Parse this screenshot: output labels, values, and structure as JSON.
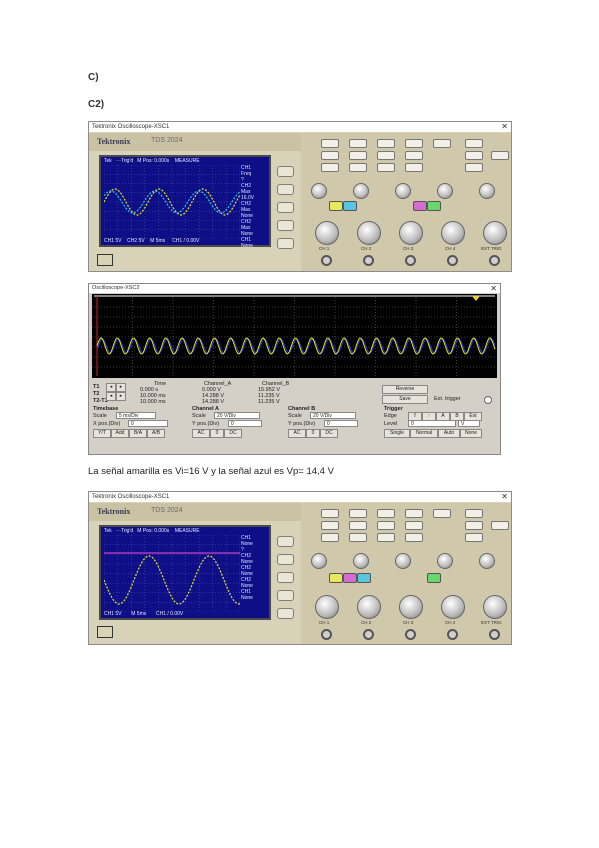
{
  "doc": {
    "heading_c": "C)",
    "heading_c2": "C2)",
    "caption": "La señal amarilla es Vi=16 V y la señal azul es Vp= 14,4 V"
  },
  "scope1": {
    "window_title": "Tektronix Oscilloscope-XSC1",
    "brand": "Tektronix",
    "model": "TDS 2024",
    "lcd_top": [
      "Tek",
      "···Trig'd",
      "M Pos: 0.000s",
      "MEASURE"
    ],
    "menu": [
      "CH1",
      "Freq",
      "?",
      "CH2",
      "Max",
      "16.0V",
      "CH2",
      "Max",
      "None",
      "CH2",
      "Max",
      "None",
      "CH1",
      "None"
    ],
    "lcd_bottom": [
      "CH1 5V",
      "CH2 5V",
      "M 5ms",
      "CH1 / 0.00V"
    ],
    "channels": [
      "CH 1",
      "CH 2",
      "CH 3",
      "CH 4",
      "EXT TRIG"
    ],
    "wave_color_a": "#e6e62a",
    "wave_color_b": "#29c6dc",
    "close": "✕"
  },
  "scope2": {
    "window_title": "Tektronix Oscilloscope-XSC1",
    "brand": "Tektronix",
    "model": "TDS 2024",
    "lcd_top": [
      "Tek",
      "···Trig'd",
      "M Pos: 0.000s",
      "MEASURE"
    ],
    "menu": [
      "CH1",
      "None",
      "?",
      "CH2",
      "None",
      "CH2",
      "None",
      "CH2",
      "None",
      "CH1",
      "None"
    ],
    "lcd_bottom": [
      "CH1 5V",
      "M 5ms",
      "CH1 / 0.00V"
    ],
    "channels": [
      "CH 1",
      "CH 2",
      "CH 3",
      "CH 4",
      "EXT TRIG"
    ],
    "wave_color_a": "#e6e62a",
    "wave_color_b": "#d43cc9",
    "close": "✕"
  },
  "trace": {
    "window_title": "Oscilloscope-XSC2",
    "close": "✕",
    "table_headers": [
      "Time",
      "Channel_A",
      "Channel_B"
    ],
    "rows": [
      [
        "0.000 s",
        "0.000 V",
        "15.952 V"
      ],
      [
        "10.000 ms",
        "14.288 V",
        "11.235 V"
      ],
      [
        "10.000 ms",
        "14.288 V",
        "11.235 V"
      ]
    ],
    "t_labels": [
      "T1",
      "T2",
      "T2-T1"
    ],
    "reverse": "Reverse",
    "save": "Save",
    "ext_trigger": "Ext. trigger",
    "timebase_label": "Timebase",
    "timebase_scale": "5 ms/Div",
    "timebase_xpos": "0",
    "channel_a_label": "Channel A",
    "channel_a_scale": "20 V/Div",
    "channel_a_ypos": "0",
    "channel_b_label": "Channel B",
    "channel_b_scale": "20 V/Div",
    "channel_b_ypos": "0",
    "trigger_label": "Trigger",
    "trigger_level": "0",
    "trigger_unit": "V",
    "scale_word": "Scale",
    "xpos_word": "X pos.(Div)",
    "ypos_word": "Y pos.(Div)",
    "edge_word": "Edge",
    "level_word": "Level",
    "tb_modes": [
      "Y/T",
      "Add",
      "B/A",
      "A/B"
    ],
    "ch_modes": [
      "AC",
      "0",
      "DC"
    ],
    "trig_modes": [
      "Single",
      "Normal",
      "Auto",
      "None"
    ],
    "trig_edges": [
      "f",
      "↑",
      "A",
      "B",
      "Ext"
    ],
    "wave_a_color": "#e4e42a",
    "wave_b_color": "#2a3bd8"
  }
}
